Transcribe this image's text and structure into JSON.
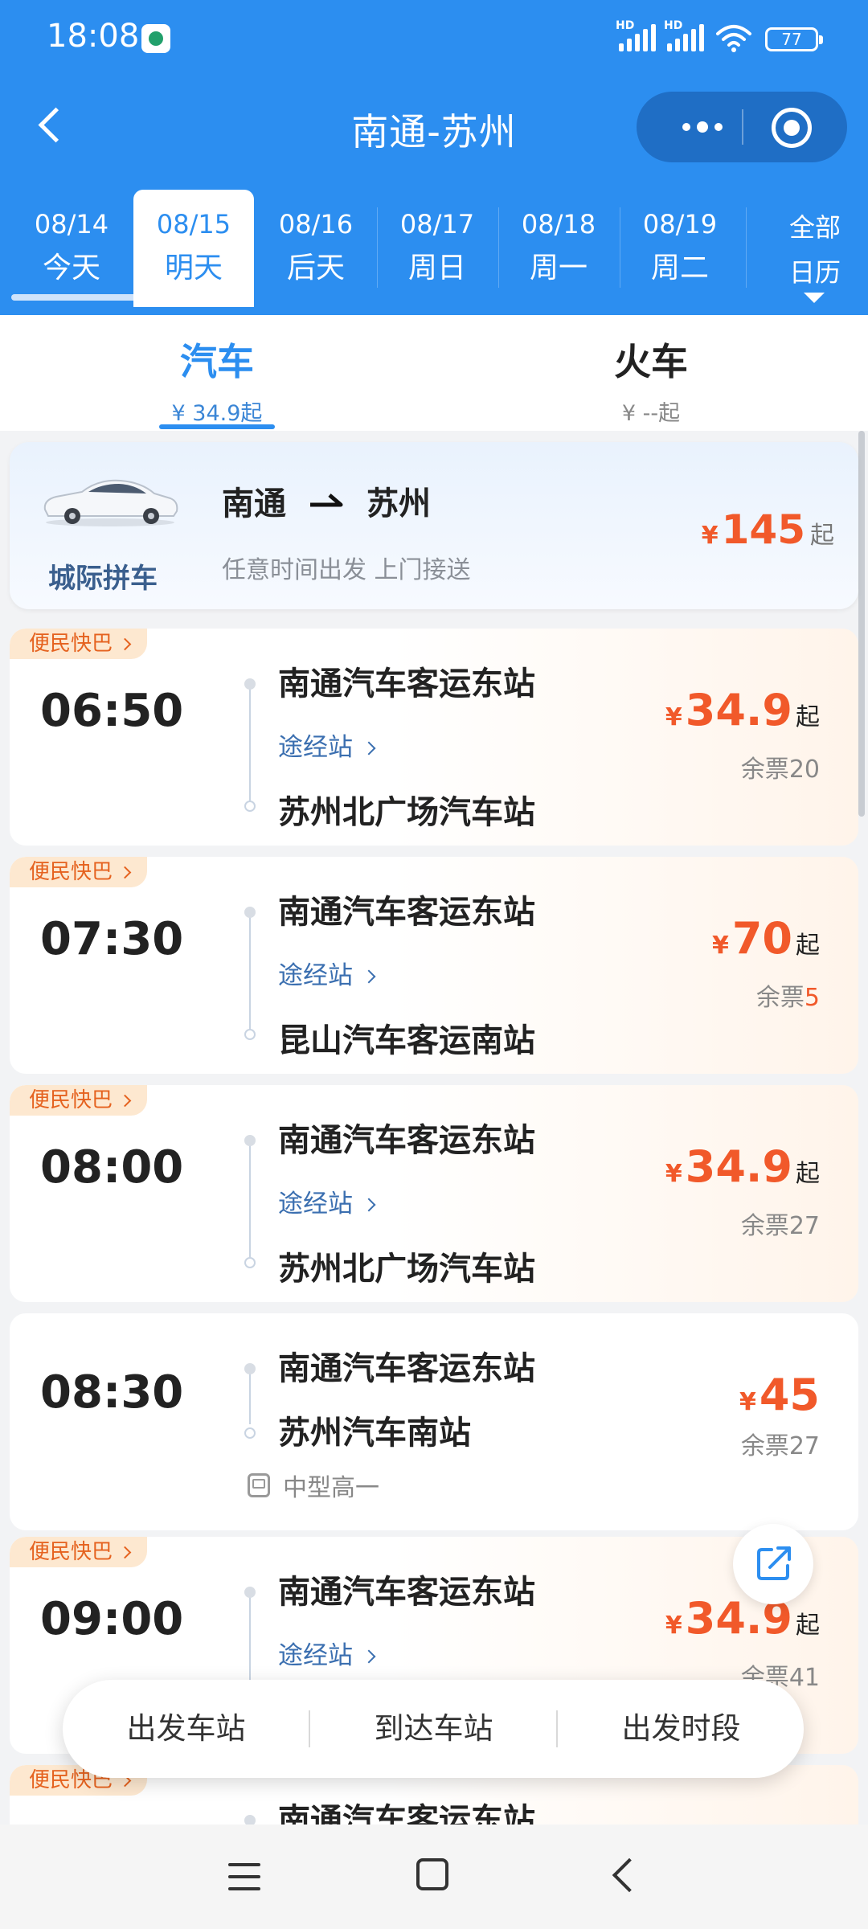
{
  "status_bar": {
    "time": "18:08",
    "hd1": "HD",
    "hd2": "HD",
    "battery": "77"
  },
  "navbar": {
    "title": "南通-苏州"
  },
  "dates": [
    {
      "date": "08/14",
      "label": "今天",
      "active": false
    },
    {
      "date": "08/15",
      "label": "明天",
      "active": true
    },
    {
      "date": "08/16",
      "label": "后天",
      "active": false
    },
    {
      "date": "08/17",
      "label": "周日",
      "active": false
    },
    {
      "date": "08/18",
      "label": "周一",
      "active": false
    },
    {
      "date": "08/19",
      "label": "周二",
      "active": false
    }
  ],
  "calendar": {
    "line1": "全部",
    "line2": "日历"
  },
  "modes": {
    "bus": {
      "label": "汽车",
      "price": "¥ 34.9起"
    },
    "train": {
      "label": "火车",
      "price": "¥ --起"
    }
  },
  "carpool": {
    "label": "城际拼车",
    "from": "南通",
    "to": "苏州",
    "desc": "任意时间出发 上门接送",
    "currency": "¥",
    "price": "145",
    "suffix": "起"
  },
  "trips": [
    {
      "tag": "便民快巴",
      "time": "06:50",
      "from": "南通汽车客运东站",
      "via": "途经站",
      "to": "苏州北广场汽车站",
      "currency": "¥",
      "price": "34.9",
      "suffix": "起",
      "remain_label": "余票",
      "remain": "20"
    },
    {
      "tag": "便民快巴",
      "time": "07:30",
      "from": "南通汽车客运东站",
      "via": "途经站",
      "to": "昆山汽车客运南站",
      "currency": "¥",
      "price": "70",
      "suffix": "起",
      "remain_label": "余票",
      "remain": "5"
    },
    {
      "tag": "便民快巴",
      "time": "08:00",
      "from": "南通汽车客运东站",
      "via": "途经站",
      "to": "苏州北广场汽车站",
      "currency": "¥",
      "price": "34.9",
      "suffix": "起",
      "remain_label": "余票",
      "remain": "27"
    },
    {
      "tag": "",
      "time": "08:30",
      "from": "南通汽车客运东站",
      "to": "苏州汽车南站",
      "bus_type": "中型高一",
      "currency": "¥",
      "price": "45",
      "remain_label": "余票",
      "remain": "27"
    },
    {
      "tag": "便民快巴",
      "time": "09:00",
      "from": "南通汽车客运东站",
      "via": "途经站",
      "currency": "¥",
      "price": "34.9",
      "suffix": "起",
      "remain_label": "余票",
      "remain": "41"
    },
    {
      "tag": "便民快巴",
      "from": "南通汽车客运东站"
    }
  ],
  "filter_bar": {
    "depart_station": "出发车站",
    "arrive_station": "到达车站",
    "depart_time": "出发时段"
  }
}
